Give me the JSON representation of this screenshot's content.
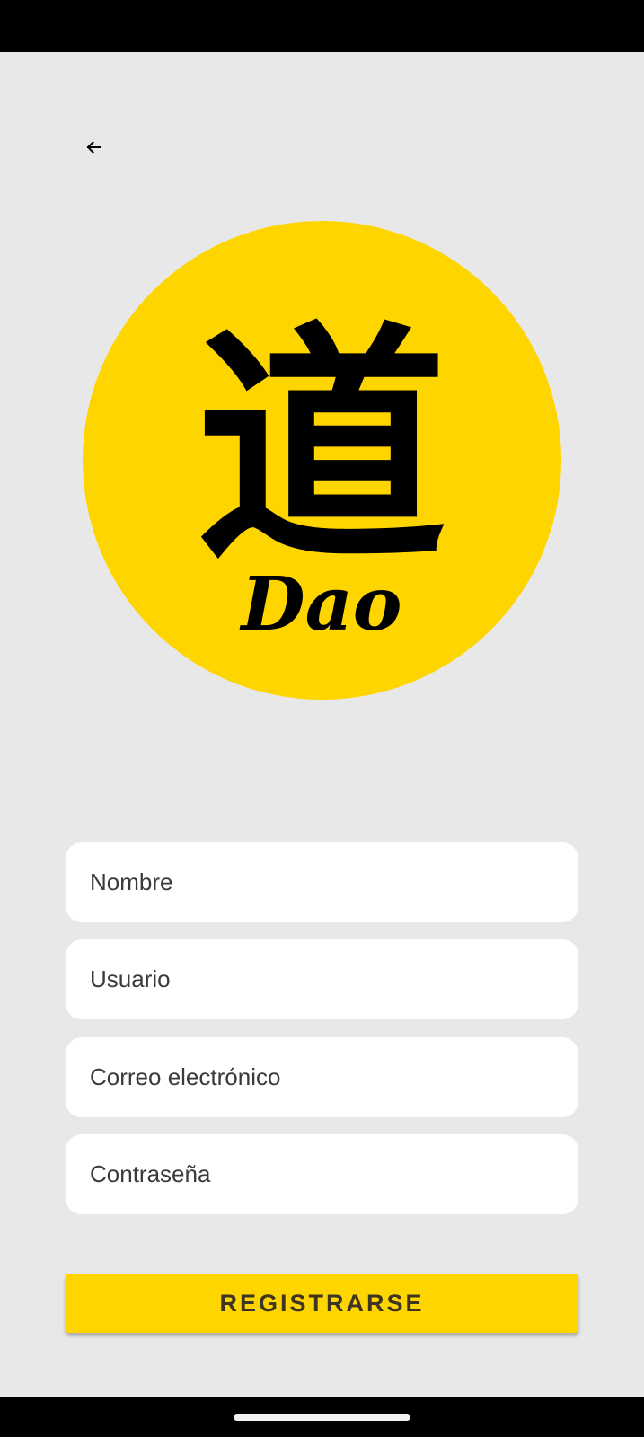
{
  "header": {
    "back_icon": "arrow-left-icon"
  },
  "logo": {
    "glyph": "道",
    "text": "Dao",
    "background_color": "#ffd500"
  },
  "form": {
    "fields": [
      {
        "name": "nombre",
        "placeholder": "Nombre",
        "value": ""
      },
      {
        "name": "usuario",
        "placeholder": "Usuario",
        "value": ""
      },
      {
        "name": "correo",
        "placeholder": "Correo electrónico",
        "value": ""
      },
      {
        "name": "contrasena",
        "placeholder": "Contraseña",
        "value": ""
      }
    ],
    "submit_label": "REGISTRARSE"
  },
  "colors": {
    "accent": "#ffd500",
    "background": "#e8e8e8",
    "field_background": "#ffffff"
  }
}
